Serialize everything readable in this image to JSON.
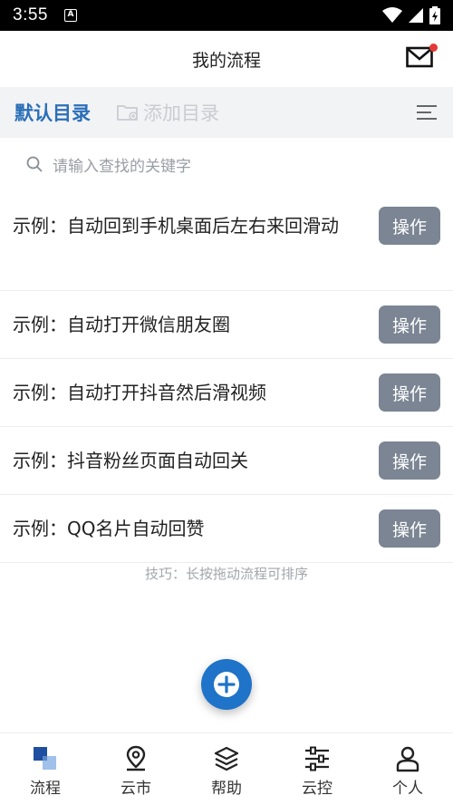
{
  "status_bar": {
    "time": "3:55",
    "notification_icon": "A",
    "icons": [
      "wifi-icon",
      "signal-icon",
      "battery-icon"
    ]
  },
  "header": {
    "title": "我的流程",
    "mail_icon": "mail-icon",
    "has_unread": true
  },
  "directory": {
    "default_label": "默认目录",
    "add_label": "添加目录",
    "menu_icon": "menu-lines-icon"
  },
  "search": {
    "placeholder": "请输入查找的关键字"
  },
  "flows": [
    {
      "name": "示例：自动回到手机桌面后左右来回滑动",
      "action": "操作"
    },
    {
      "name": "示例：自动打开微信朋友圈",
      "action": "操作"
    },
    {
      "name": "示例：自动打开抖音然后滑视频",
      "action": "操作"
    },
    {
      "name": "示例：抖音粉丝页面自动回关",
      "action": "操作"
    },
    {
      "name": "示例：QQ名片自动回赞",
      "action": "操作"
    }
  ],
  "tip": "技巧：长按拖动流程可排序",
  "tabs": [
    {
      "label": "流程",
      "icon": "flow-icon",
      "active": true
    },
    {
      "label": "云市",
      "icon": "location-pin-icon",
      "active": false
    },
    {
      "label": "帮助",
      "icon": "layers-icon",
      "active": false
    },
    {
      "label": "云控",
      "icon": "sliders-icon",
      "active": false
    },
    {
      "label": "个人",
      "icon": "person-icon",
      "active": false
    }
  ],
  "colors": {
    "accent": "#2a6fb8",
    "fab": "#1f73c8",
    "button": "#7b8593",
    "unread": "#e53935"
  }
}
